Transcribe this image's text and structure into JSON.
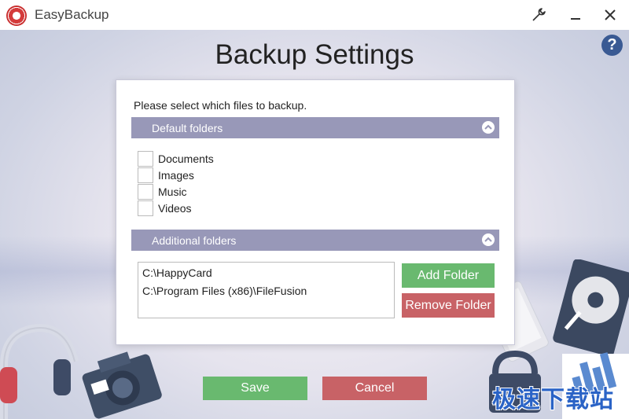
{
  "window": {
    "app_title": "EasyBackup"
  },
  "toolbar": {
    "settings_icon": "wrench-icon",
    "minimize_icon": "minimize-icon",
    "close_icon": "close-icon",
    "help_label": "?"
  },
  "page": {
    "title": "Backup Settings",
    "prompt": "Please select which files to backup."
  },
  "default_folders": {
    "header": "Default folders",
    "items": [
      {
        "label": "Documents",
        "checked": false
      },
      {
        "label": "Images",
        "checked": false
      },
      {
        "label": "Music",
        "checked": false
      },
      {
        "label": "Videos",
        "checked": false
      }
    ]
  },
  "additional_folders": {
    "header": "Additional folders",
    "folders": [
      "C:\\HappyCard",
      "C:\\Program Files (x86)\\FileFusion"
    ],
    "add_label": "Add Folder",
    "remove_label": "Remove Folder"
  },
  "actions": {
    "save_label": "Save",
    "cancel_label": "Cancel"
  },
  "colors": {
    "section_bar": "#9898b8",
    "green": "#69b96f",
    "red": "#c86266",
    "help": "#3a5a93"
  },
  "watermark": "极速下载站"
}
